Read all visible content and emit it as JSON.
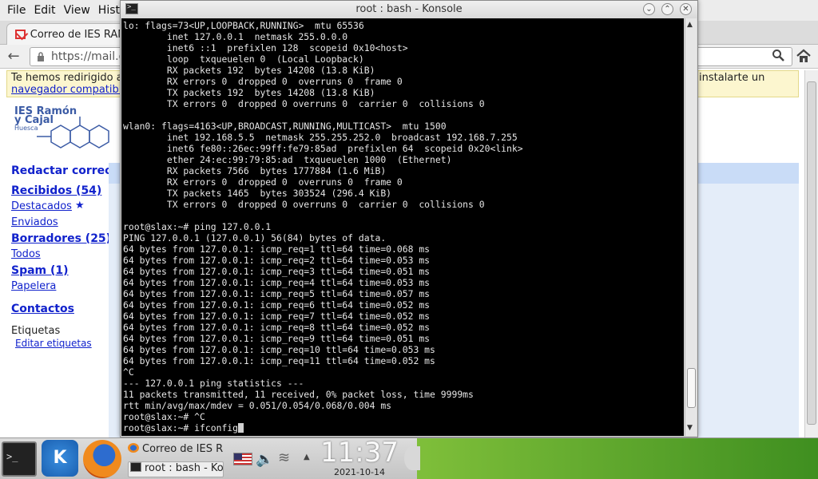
{
  "browser": {
    "menu": [
      "File",
      "Edit",
      "View",
      "Histo"
    ],
    "tab_title": "Correo de IES RAN",
    "url": "https://mail.g",
    "notice": {
      "text": "Te hemos redirigido a",
      "link": "navegador compatibl",
      "right_text": "instalarte un"
    },
    "logo": {
      "line1": "IES Ramón",
      "line2": "y Cajal",
      "sub": "Huesca"
    },
    "sidebar": {
      "compose": "Redactar correo",
      "inbox": "Recibidos (54)",
      "starred": "Destacados",
      "sent": "Enviados",
      "drafts": "Borradores (25)",
      "all": "Todos",
      "spam": "Spam (1)",
      "trash": "Papelera",
      "contacts": "Contactos",
      "labels_title": "Etiquetas",
      "edit_labels": "Editar etiquetas"
    }
  },
  "konsole": {
    "title": "root : bash - Konsole",
    "lines": [
      "lo: flags=73<UP,LOOPBACK,RUNNING>  mtu 65536",
      "        inet 127.0.0.1  netmask 255.0.0.0",
      "        inet6 ::1  prefixlen 128  scopeid 0x10<host>",
      "        loop  txqueuelen 0  (Local Loopback)",
      "        RX packets 192  bytes 14208 (13.8 KiB)",
      "        RX errors 0  dropped 0  overruns 0  frame 0",
      "        TX packets 192  bytes 14208 (13.8 KiB)",
      "        TX errors 0  dropped 0 overruns 0  carrier 0  collisions 0",
      "",
      "wlan0: flags=4163<UP,BROADCAST,RUNNING,MULTICAST>  mtu 1500",
      "        inet 192.168.5.5  netmask 255.255.252.0  broadcast 192.168.7.255",
      "        inet6 fe80::26ec:99ff:fe79:85ad  prefixlen 64  scopeid 0x20<link>",
      "        ether 24:ec:99:79:85:ad  txqueuelen 1000  (Ethernet)",
      "        RX packets 7566  bytes 1777884 (1.6 MiB)",
      "        RX errors 0  dropped 0  overruns 0  frame 0",
      "        TX packets 1465  bytes 303524 (296.4 KiB)",
      "        TX errors 0  dropped 0 overruns 0  carrier 0  collisions 0",
      "",
      "root@slax:~# ping 127.0.0.1",
      "PING 127.0.0.1 (127.0.0.1) 56(84) bytes of data.",
      "64 bytes from 127.0.0.1: icmp_req=1 ttl=64 time=0.068 ms",
      "64 bytes from 127.0.0.1: icmp_req=2 ttl=64 time=0.053 ms",
      "64 bytes from 127.0.0.1: icmp_req=3 ttl=64 time=0.051 ms",
      "64 bytes from 127.0.0.1: icmp_req=4 ttl=64 time=0.053 ms",
      "64 bytes from 127.0.0.1: icmp_req=5 ttl=64 time=0.057 ms",
      "64 bytes from 127.0.0.1: icmp_req=6 ttl=64 time=0.052 ms",
      "64 bytes from 127.0.0.1: icmp_req=7 ttl=64 time=0.052 ms",
      "64 bytes from 127.0.0.1: icmp_req=8 ttl=64 time=0.052 ms",
      "64 bytes from 127.0.0.1: icmp_req=9 ttl=64 time=0.051 ms",
      "64 bytes from 127.0.0.1: icmp_req=10 ttl=64 time=0.053 ms",
      "64 bytes from 127.0.0.1: icmp_req=11 ttl=64 time=0.052 ms",
      "^C",
      "--- 127.0.0.1 ping statistics ---",
      "11 packets transmitted, 11 received, 0% packet loss, time 9999ms",
      "rtt min/avg/max/mdev = 0.051/0.054/0.068/0.004 ms",
      "root@slax:~# ^C"
    ],
    "prompt_line": "root@slax:~# ifconfig"
  },
  "taskbar": {
    "task_browser": "Correo de IES R",
    "task_konsole": "root : bash - Ko",
    "clock_time": "11:37",
    "clock_date": "2021-10-14"
  },
  "icons": {
    "gmail": "gmail-icon",
    "lock": "lock-icon",
    "search": "search-icon",
    "home": "home-icon",
    "star": "star-icon",
    "konsole": "terminal-icon",
    "kde": "kde-menu-icon",
    "firefox": "firefox-icon",
    "flag": "us-flag-icon",
    "volume": "volume-icon",
    "wifi": "wifi-icon"
  },
  "colors": {
    "link": "#1122cc",
    "terminal_bg": "#000000",
    "terminal_fg": "#e6e6e6",
    "notice_bg": "#fcf6cf",
    "desktop_green": "#5aa62e"
  }
}
